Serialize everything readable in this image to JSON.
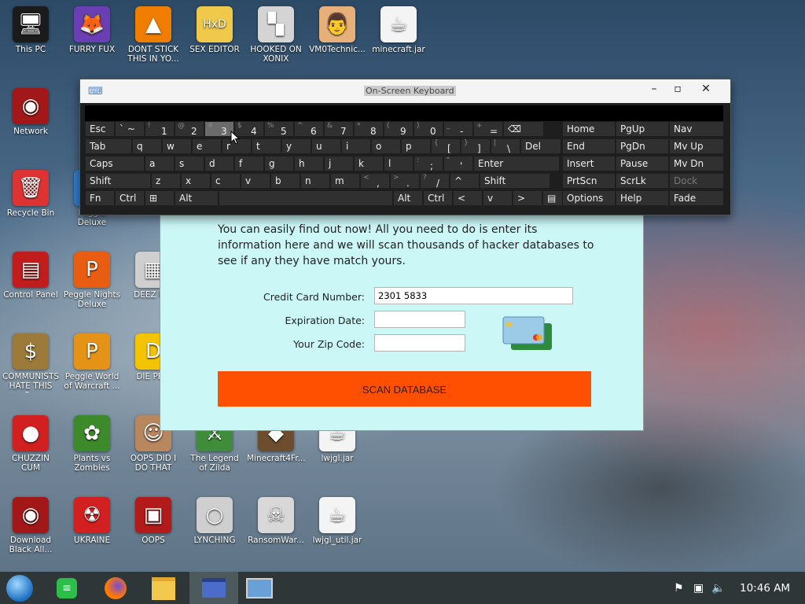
{
  "desktop_icons": [
    {
      "label": "This PC",
      "icon": "computer-icon",
      "glyph": "🖥",
      "bg": "#1b1b1b"
    },
    {
      "label": "FURRY FUX",
      "icon": "firefox-icon",
      "glyph": "🦊",
      "bg": "#6b3fb4"
    },
    {
      "label": "DONT STICK THIS IN YO...",
      "icon": "vlc-cone-icon",
      "glyph": "▲",
      "bg": "#ef7d00"
    },
    {
      "label": "SEX EDITOR",
      "icon": "hxd-icon",
      "glyph": "HxD",
      "bg": "#f0c84a"
    },
    {
      "label": "HOOKED ON XONIX",
      "icon": "xonix-icon",
      "glyph": "▚",
      "bg": "#d4d4d4"
    },
    {
      "label": "VM0Technic...",
      "icon": "doctor-icon",
      "glyph": "👨",
      "bg": "#e7b07a"
    },
    {
      "label": "minecraft.jar",
      "icon": "java-icon",
      "glyph": "☕",
      "bg": "#f4f4f4"
    },
    {
      "label": "Network",
      "icon": "network-icon",
      "glyph": "◉",
      "bg": "#a21818"
    },
    {
      "label": "Recycle Bin",
      "icon": "recycle-bin-icon",
      "glyph": "🗑",
      "bg": "#d33"
    },
    {
      "label": "Peggle Deluxe",
      "icon": "peggle-icon",
      "glyph": "P",
      "bg": "#2f7fd0"
    },
    {
      "label": "Control Panel",
      "icon": "control-panel-icon",
      "glyph": "▤",
      "bg": "#c21d1d"
    },
    {
      "label": "Peggle Nights Deluxe",
      "icon": "peggle-nights-icon",
      "glyph": "P",
      "bg": "#e85d12"
    },
    {
      "label": "DEEZ N...",
      "icon": "deez-icon",
      "glyph": "▦",
      "bg": "#cfcfcf"
    },
    {
      "label": "COMMUNISTS HATE THIS G...",
      "icon": "money-bag-icon",
      "glyph": "$",
      "bg": "#9c7a3a"
    },
    {
      "label": "Peggle World of Warcraft ...",
      "icon": "peggle-wow-icon",
      "glyph": "P",
      "bg": "#e59316"
    },
    {
      "label": "DIE PL...",
      "icon": "die-icon",
      "glyph": "D",
      "bg": "#f5c400"
    },
    {
      "label": "CHUZZIN CUM",
      "icon": "chuzzle-icon",
      "glyph": "●",
      "bg": "#d12020"
    },
    {
      "label": "Plants vs Zombies",
      "icon": "pvz-icon",
      "glyph": "✿",
      "bg": "#3d8a2a"
    },
    {
      "label": "OOPS DID I DO THAT",
      "icon": "portrait-icon",
      "glyph": "☺",
      "bg": "#b9875e"
    },
    {
      "label": "The Legend of Zilda",
      "icon": "zelda-icon",
      "glyph": "⚔",
      "bg": "#3f8c3b"
    },
    {
      "label": "Minecraft4Fr...",
      "icon": "minecraft-icon",
      "glyph": "◆",
      "bg": "#6d4d2d"
    },
    {
      "label": "lwjgl.jar",
      "icon": "java-icon",
      "glyph": "☕",
      "bg": "#f4f4f4"
    },
    {
      "label": "Download Black All...",
      "icon": "network-icon",
      "glyph": "◉",
      "bg": "#a21818"
    },
    {
      "label": "UKRAINE",
      "icon": "radiation-icon",
      "glyph": "☢",
      "bg": "#d21f1f"
    },
    {
      "label": "OOPS",
      "icon": "app-icon",
      "glyph": "▣",
      "bg": "#b31a1a"
    },
    {
      "label": "LYNCHING",
      "icon": "noose-icon",
      "glyph": "○",
      "bg": "#cfcfcf"
    },
    {
      "label": "RansomWar...",
      "icon": "skull-icon",
      "glyph": "☠",
      "bg": "#d8d8d8"
    },
    {
      "label": "lwjgl_util.jar",
      "icon": "java-icon",
      "glyph": "☕",
      "bg": "#f4f4f4"
    }
  ],
  "osk": {
    "title": "On-Screen Keyboard",
    "rows": [
      [
        {
          "m": "Esc"
        },
        {
          "m": "` ~",
          "s": ""
        },
        {
          "s": "!",
          "m": "1"
        },
        {
          "s": "@",
          "m": "2"
        },
        {
          "s": "#",
          "m": "3"
        },
        {
          "s": "$",
          "m": "4"
        },
        {
          "s": "%",
          "m": "5"
        },
        {
          "s": "^",
          "m": "6"
        },
        {
          "s": "&",
          "m": "7"
        },
        {
          "s": "*",
          "m": "8"
        },
        {
          "s": "(",
          "m": "9"
        },
        {
          "s": ")",
          "m": "0"
        },
        {
          "s": "_",
          "m": "-"
        },
        {
          "s": "+",
          "m": "="
        },
        {
          "m": "⌫"
        }
      ],
      [
        {
          "m": "Tab"
        },
        {
          "m": "q"
        },
        {
          "m": "w"
        },
        {
          "m": "e"
        },
        {
          "m": "r"
        },
        {
          "m": "t"
        },
        {
          "m": "y"
        },
        {
          "m": "u"
        },
        {
          "m": "i"
        },
        {
          "m": "o"
        },
        {
          "m": "p"
        },
        {
          "s": "{",
          "m": "["
        },
        {
          "s": "}",
          "m": "]"
        },
        {
          "s": "|",
          "m": "\\"
        },
        {
          "m": "Del"
        }
      ],
      [
        {
          "m": "Caps"
        },
        {
          "m": "a"
        },
        {
          "m": "s"
        },
        {
          "m": "d"
        },
        {
          "m": "f"
        },
        {
          "m": "g"
        },
        {
          "m": "h"
        },
        {
          "m": "j"
        },
        {
          "m": "k"
        },
        {
          "m": "l"
        },
        {
          "s": ":",
          "m": ";"
        },
        {
          "s": "\"",
          "m": "'"
        },
        {
          "m": "Enter"
        }
      ],
      [
        {
          "m": "Shift"
        },
        {
          "m": "z"
        },
        {
          "m": "x"
        },
        {
          "m": "c"
        },
        {
          "m": "v"
        },
        {
          "m": "b"
        },
        {
          "m": "n"
        },
        {
          "m": "m"
        },
        {
          "s": "<",
          "m": ","
        },
        {
          "s": ">",
          "m": "."
        },
        {
          "s": "?",
          "m": "/"
        },
        {
          "m": "^"
        },
        {
          "m": "Shift"
        }
      ],
      [
        {
          "m": "Fn"
        },
        {
          "m": "Ctrl"
        },
        {
          "m": "⊞"
        },
        {
          "m": "Alt"
        },
        {
          "m": ""
        },
        {
          "m": "Alt"
        },
        {
          "m": "Ctrl"
        },
        {
          "m": "<"
        },
        {
          "m": "v"
        },
        {
          "m": ">"
        },
        {
          "m": "▤"
        }
      ]
    ],
    "nav_keys": [
      [
        "Home",
        "PgUp",
        "Nav"
      ],
      [
        "End",
        "PgDn",
        "Mv Up"
      ],
      [
        "Insert",
        "Pause",
        "Mv Dn"
      ],
      [
        "PrtScn",
        "ScrLk",
        "Dock"
      ],
      [
        "Options",
        "Help",
        "Fade"
      ]
    ],
    "highlighted_key": "3"
  },
  "scanner": {
    "intro": "You can easily find out now! All you need to do is enter its information here and we will scan thousands of hacker databases to see if any they have match yours.",
    "cc_label": "Credit Card Number:",
    "cc_value": "2301 5833",
    "exp_label": "Expiration Date:",
    "exp_value": "",
    "zip_label": "Your Zip Code:",
    "zip_value": "",
    "button": "SCAN DATABASE"
  },
  "taskbar": {
    "clock": "10:46 AM",
    "apps": [
      "start-orb-icon",
      "notes-icon",
      "firefox-icon",
      "file-explorer-icon",
      "card-app-icon",
      "osk-app-icon"
    ]
  },
  "colors": {
    "scan_button": "#ff4f00",
    "scanner_bg": "#ccf7f7",
    "taskbar": "#2f3638",
    "osk_bg": "#1e1e1e"
  }
}
